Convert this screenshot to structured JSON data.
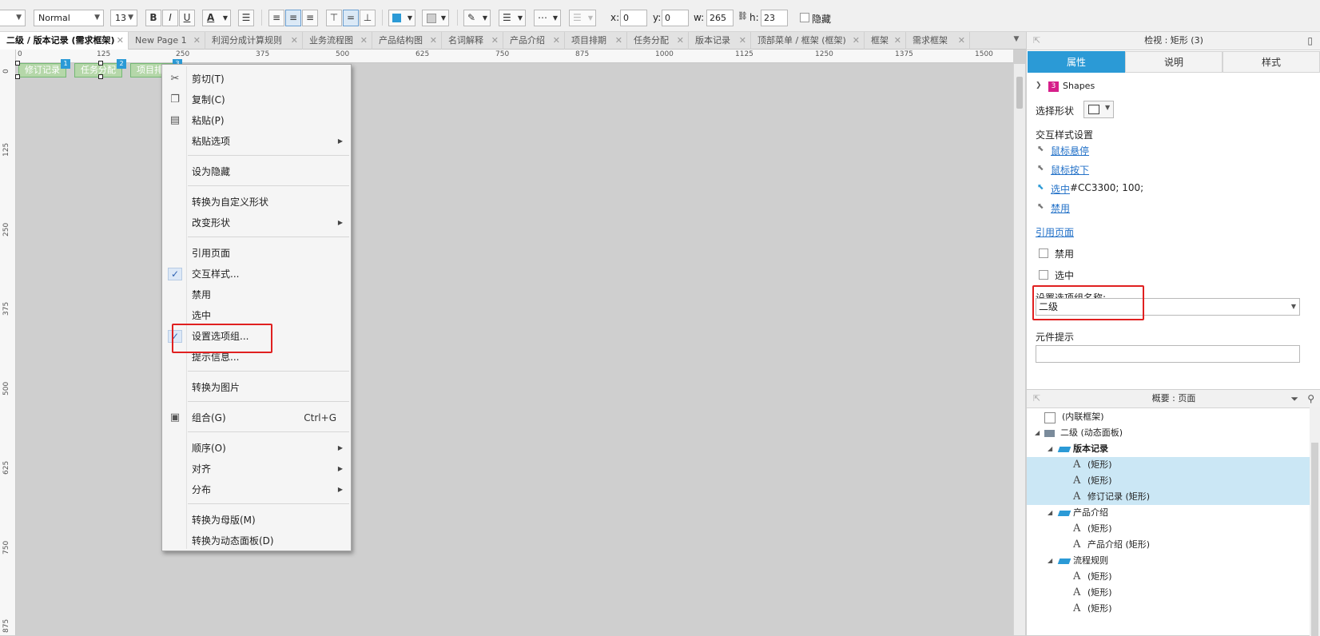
{
  "toolbar": {
    "font_style": "Normal",
    "font_size": "13",
    "bold": "B",
    "italic": "I",
    "underline": "U",
    "font_color": "A",
    "x_label": "x:",
    "x_value": "0",
    "y_label": "y:",
    "y_value": "0",
    "w_label": "w:",
    "w_value": "265",
    "h_label": "h:",
    "h_value": "23",
    "hide_label": "隐藏"
  },
  "tabs": [
    {
      "label": "二级 / 版本记录 (需求框架)",
      "active": true
    },
    {
      "label": "New Page 1"
    },
    {
      "label": "利润分成计算规则"
    },
    {
      "label": "业务流程图"
    },
    {
      "label": "产品结构图"
    },
    {
      "label": "名词解释"
    },
    {
      "label": "产品介绍"
    },
    {
      "label": "项目排期"
    },
    {
      "label": "任务分配"
    },
    {
      "label": "版本记录"
    },
    {
      "label": "顶部菜单 / 框架 (框架)"
    },
    {
      "label": "框架"
    },
    {
      "label": "需求框架"
    }
  ],
  "ruler": {
    "h_ticks": [
      "0",
      "125",
      "250",
      "375",
      "500",
      "625",
      "750",
      "875",
      "1000",
      "1125",
      "1250",
      "1375",
      "1500"
    ],
    "v_ticks": [
      "0",
      "125",
      "250",
      "375",
      "500",
      "625",
      "750",
      "875"
    ]
  },
  "canvas_shapes": [
    {
      "label": "修订记录",
      "badge": "1"
    },
    {
      "label": "任务分配",
      "badge": "2"
    },
    {
      "label": "项目排期",
      "badge": "3"
    }
  ],
  "context_menu": {
    "cut": "剪切(T)",
    "copy": "复制(C)",
    "paste": "粘贴(P)",
    "paste_options": "粘贴选项",
    "set_hidden": "设为隐藏",
    "convert_custom_shape": "转换为自定义形状",
    "change_shape": "改变形状",
    "reference_page": "引用页面",
    "interaction_styles": "交互样式...",
    "disabled": "禁用",
    "selected": "选中",
    "set_option_group": "设置选项组...",
    "tooltip": "提示信息...",
    "convert_image": "转换为图片",
    "group": "组合(G)",
    "group_shortcut": "Ctrl+G",
    "order": "顺序(O)",
    "align": "对齐",
    "distribute": "分布",
    "convert_master": "转换为母版(M)",
    "convert_dynamic_panel": "转换为动态面板(D)",
    "check_mark": "✓"
  },
  "inspector": {
    "title": "检视 : 矩形 (3)",
    "tabs": [
      "属性",
      "说明",
      "样式"
    ],
    "shapes_count": "3",
    "shapes_label": "Shapes",
    "select_shape_label": "选择形状",
    "interaction_style_header": "交互样式设置",
    "mouse_over": "鼠标悬停",
    "mouse_down": "鼠标按下",
    "selected_link": "选中",
    "selected_value": "#CC3300; 100;",
    "disabled_link": "禁用",
    "reference_page": "引用页面",
    "disabled_cb": "禁用",
    "selected_cb": "选中",
    "option_group_label": "设置选项组名称:",
    "option_group_value": "二级",
    "tooltip_label": "元件提示",
    "tooltip_value": ""
  },
  "outline": {
    "title": "概要 : 页面",
    "rows": [
      {
        "text": "(内联框架)",
        "level": 1,
        "icon": "frame",
        "expand": ""
      },
      {
        "text": "二级 (动态面板)",
        "level": 0,
        "icon": "panel",
        "expand": "◢"
      },
      {
        "text": "版本记录",
        "level": 1,
        "icon": "state",
        "expand": "◢",
        "bold": true
      },
      {
        "text": "(矩形)",
        "level": 2,
        "icon": "text",
        "expand": "",
        "selected": true
      },
      {
        "text": "(矩形)",
        "level": 2,
        "icon": "text",
        "expand": "",
        "selected": true
      },
      {
        "text": "修订记录 (矩形)",
        "level": 2,
        "icon": "text",
        "expand": "",
        "selected": true
      },
      {
        "text": "产品介绍",
        "level": 1,
        "icon": "state",
        "expand": "◢"
      },
      {
        "text": "(矩形)",
        "level": 2,
        "icon": "text",
        "expand": ""
      },
      {
        "text": "产品介绍 (矩形)",
        "level": 2,
        "icon": "text",
        "expand": ""
      },
      {
        "text": "流程规则",
        "level": 1,
        "icon": "state",
        "expand": "◢"
      },
      {
        "text": "(矩形)",
        "level": 2,
        "icon": "text",
        "expand": ""
      },
      {
        "text": "(矩形)",
        "level": 2,
        "icon": "text",
        "expand": ""
      },
      {
        "text": "(矩形)",
        "level": 2,
        "icon": "text",
        "expand": ""
      }
    ]
  },
  "colors": {
    "accent": "#2b9ad6",
    "highlight_box": "#e02020",
    "selected_row": "#cbe7f5",
    "shapes_badge": "#d61f8a"
  }
}
